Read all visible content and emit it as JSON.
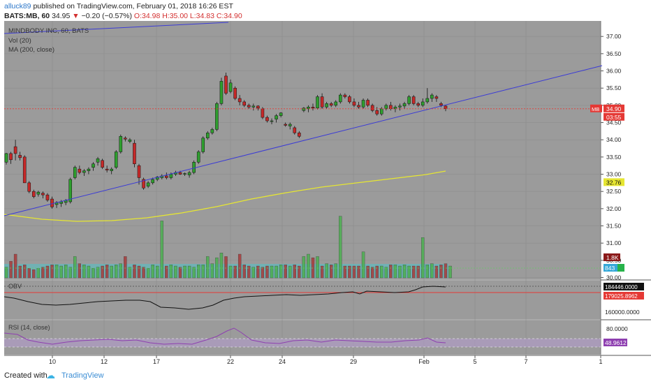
{
  "header": {
    "author": "alluck89",
    "published": "published on TradingView.com, February 01, 2018 16:26 EST",
    "symbol": "BATS:MB, 60",
    "last": "34.95",
    "change": "−0.20 (−0.57%)",
    "ohlc_o": "O:34.98",
    "ohlc_h": "H:35.00",
    "ohlc_l": "L:34.83",
    "ohlc_c": "C:34.90"
  },
  "legend": {
    "main": "MINDBODY INC, 60, BATS",
    "vol": "Vol (20)",
    "ma": "MA (200, close)",
    "obv": "OBV",
    "rsi": "RSI (14, close)"
  },
  "footer": {
    "created_with": "Created with",
    "brand": "TradingView"
  },
  "chart_data": {
    "type": "candlestick",
    "price_axis": {
      "ticks": [
        "37.00",
        "36.50",
        "36.00",
        "35.50",
        "35.00",
        "34.50",
        "34.00",
        "33.50",
        "33.00",
        "32.50",
        "32.00",
        "31.50",
        "31.00",
        "30.50",
        "30.00"
      ],
      "range": [
        29.95,
        37.45
      ]
    },
    "time_axis": {
      "ticks": [
        "10",
        "12",
        "17",
        "22",
        "24",
        "29",
        "Feb",
        "5",
        "7",
        "1"
      ]
    },
    "candles": [
      [
        33.35,
        33.62,
        33.28,
        33.6
      ],
      [
        33.6,
        33.65,
        33.3,
        33.42
      ],
      [
        33.8,
        34.0,
        33.4,
        33.6
      ],
      [
        33.55,
        33.65,
        33.4,
        33.48
      ],
      [
        33.5,
        33.55,
        32.8,
        32.75
      ],
      [
        32.75,
        32.8,
        32.45,
        32.5
      ],
      [
        32.5,
        32.55,
        32.3,
        32.35
      ],
      [
        32.42,
        32.52,
        32.35,
        32.48
      ],
      [
        32.45,
        32.5,
        32.3,
        32.4
      ],
      [
        32.4,
        32.45,
        32.2,
        32.25
      ],
      [
        32.28,
        32.35,
        32.0,
        32.05
      ],
      [
        32.12,
        32.22,
        32.02,
        32.18
      ],
      [
        32.15,
        32.25,
        32.05,
        32.2
      ],
      [
        32.18,
        32.28,
        32.1,
        32.24
      ],
      [
        32.2,
        32.9,
        32.15,
        32.85
      ],
      [
        32.9,
        33.25,
        32.85,
        33.2
      ],
      [
        33.15,
        33.25,
        33.0,
        33.05
      ],
      [
        33.05,
        33.15,
        32.95,
        33.1
      ],
      [
        33.1,
        33.2,
        33.0,
        33.15
      ],
      [
        33.2,
        33.35,
        33.1,
        33.3
      ],
      [
        33.35,
        33.5,
        33.25,
        33.45
      ],
      [
        33.4,
        33.45,
        33.15,
        33.2
      ],
      [
        33.15,
        33.25,
        33.05,
        33.12
      ],
      [
        33.1,
        33.2,
        33.0,
        33.15
      ],
      [
        33.2,
        33.7,
        33.15,
        33.65
      ],
      [
        33.65,
        34.15,
        33.6,
        34.1
      ],
      [
        34.05,
        34.1,
        33.95,
        34.02
      ],
      [
        33.95,
        34.05,
        33.9,
        34.0
      ],
      [
        33.9,
        34.0,
        33.2,
        33.3
      ],
      [
        33.25,
        33.3,
        32.7,
        32.9
      ],
      [
        32.85,
        32.9,
        32.55,
        32.6
      ],
      [
        32.65,
        32.8,
        32.6,
        32.75
      ],
      [
        32.75,
        32.9,
        32.7,
        32.85
      ],
      [
        32.85,
        32.95,
        32.8,
        32.92
      ],
      [
        32.9,
        33.0,
        32.85,
        32.95
      ],
      [
        32.95,
        33.05,
        32.85,
        32.9
      ],
      [
        32.9,
        33.05,
        32.85,
        33.0
      ],
      [
        33.0,
        33.1,
        32.95,
        33.05
      ],
      [
        33.05,
        33.1,
        32.98,
        33.0
      ],
      [
        33.0,
        33.05,
        32.95,
        33.02
      ],
      [
        32.98,
        33.1,
        32.9,
        33.05
      ],
      [
        33.05,
        33.4,
        33.0,
        33.35
      ],
      [
        33.35,
        33.7,
        33.3,
        33.65
      ],
      [
        33.65,
        34.1,
        33.6,
        34.05
      ],
      [
        34.05,
        34.25,
        34.0,
        34.2
      ],
      [
        34.2,
        34.35,
        34.15,
        34.3
      ],
      [
        34.3,
        35.1,
        34.25,
        35.05
      ],
      [
        35.05,
        35.8,
        35.0,
        35.7
      ],
      [
        35.85,
        35.95,
        35.3,
        35.35
      ],
      [
        35.4,
        35.75,
        35.35,
        35.65
      ],
      [
        35.5,
        35.55,
        35.15,
        35.2
      ],
      [
        35.2,
        35.3,
        35.0,
        35.1
      ],
      [
        35.1,
        35.15,
        34.95,
        35.0
      ],
      [
        35.0,
        35.05,
        34.9,
        34.95
      ],
      [
        34.95,
        35.05,
        34.85,
        34.98
      ],
      [
        34.98,
        35.0,
        34.85,
        34.92
      ],
      [
        34.9,
        34.95,
        34.6,
        34.65
      ],
      [
        34.65,
        34.7,
        34.5,
        34.55
      ],
      [
        34.55,
        34.62,
        34.45,
        34.55
      ],
      [
        34.6,
        34.75,
        34.5,
        34.7
      ],
      [
        34.7,
        34.8,
        34.65,
        34.78
      ],
      [
        34.45,
        34.5,
        34.38,
        34.42
      ],
      [
        34.4,
        34.5,
        34.3,
        34.45
      ],
      [
        34.35,
        34.4,
        34.15,
        34.2
      ],
      [
        34.2,
        34.25,
        34.05,
        34.1
      ],
      [
        34.85,
        34.95,
        34.8,
        34.92
      ],
      [
        34.9,
        35.0,
        34.8,
        34.95
      ],
      [
        34.95,
        35.05,
        34.85,
        34.92
      ],
      [
        34.92,
        35.3,
        34.88,
        35.25
      ],
      [
        35.25,
        35.35,
        34.9,
        34.95
      ],
      [
        34.95,
        35.1,
        34.9,
        35.05
      ],
      [
        35.05,
        35.1,
        34.95,
        35.0
      ],
      [
        35.0,
        35.15,
        34.95,
        35.1
      ],
      [
        35.1,
        35.35,
        35.05,
        35.3
      ],
      [
        35.3,
        35.35,
        35.2,
        35.25
      ],
      [
        35.25,
        35.3,
        35.05,
        35.1
      ],
      [
        35.1,
        35.2,
        34.95,
        35.0
      ],
      [
        35.0,
        35.1,
        34.9,
        34.95
      ],
      [
        34.95,
        35.2,
        34.9,
        35.15
      ],
      [
        35.15,
        35.2,
        34.95,
        35.0
      ],
      [
        35.0,
        35.05,
        34.8,
        34.85
      ],
      [
        34.85,
        34.95,
        34.7,
        34.75
      ],
      [
        34.75,
        34.95,
        34.7,
        34.9
      ],
      [
        34.9,
        35.05,
        34.85,
        35.0
      ],
      [
        35.0,
        35.1,
        34.85,
        34.9
      ],
      [
        34.9,
        35.0,
        34.8,
        34.95
      ],
      [
        34.95,
        35.05,
        34.85,
        34.98
      ],
      [
        34.98,
        35.1,
        34.9,
        35.05
      ],
      [
        35.05,
        35.3,
        35.0,
        35.25
      ],
      [
        35.25,
        35.3,
        35.0,
        35.05
      ],
      [
        35.05,
        35.1,
        34.95,
        35.0
      ],
      [
        35.0,
        35.2,
        34.95,
        35.1
      ],
      [
        35.1,
        35.5,
        35.05,
        35.2
      ],
      [
        35.2,
        35.35,
        35.1,
        35.3
      ],
      [
        35.25,
        35.3,
        35.1,
        35.2
      ],
      [
        35.05,
        35.1,
        34.95,
        35.0
      ],
      [
        34.98,
        35.0,
        34.83,
        34.9
      ]
    ],
    "volume": [
      0.45,
      0.7,
      1.0,
      0.5,
      0.55,
      0.4,
      0.35,
      0.4,
      0.45,
      0.5,
      0.55,
      0.55,
      0.5,
      0.55,
      0.45,
      0.9,
      0.6,
      0.55,
      0.5,
      0.4,
      0.45,
      0.5,
      0.55,
      0.5,
      0.55,
      0.6,
      0.9,
      0.45,
      0.55,
      0.5,
      0.45,
      0.4,
      0.55,
      0.5,
      2.4,
      0.5,
      0.55,
      0.5,
      0.45,
      0.5,
      0.5,
      0.45,
      0.55,
      0.55,
      0.9,
      0.6,
      0.85,
      1.05,
      0.9,
      0.5,
      0.5,
      1.0,
      0.55,
      0.5,
      0.45,
      0.5,
      0.45,
      0.5,
      0.5,
      0.5,
      0.55,
      0.55,
      0.5,
      0.55,
      0.5,
      0.9,
      1.0,
      0.85,
      0.9,
      0.5,
      0.6,
      0.55,
      0.6,
      2.6,
      0.5,
      0.5,
      0.5,
      0.5,
      1.1,
      0.5,
      0.45,
      0.5,
      0.5,
      0.45,
      0.55,
      0.55,
      0.5,
      0.55,
      0.5,
      0.5,
      0.5,
      1.7,
      0.55,
      0.6,
      0.5,
      0.55,
      0.6,
      0.5
    ],
    "volume_labels": {
      "last": "1.8K",
      "avg": "843"
    },
    "ma200": {
      "label": "32.76"
    },
    "price_label": {
      "symbol": "MB",
      "value": "34.90",
      "time": "03:55"
    },
    "obv": {
      "ticks": [
        "160000.0000"
      ],
      "labels": [
        "184446.0000",
        "179025.8962"
      ]
    },
    "rsi": {
      "ticks": [
        "80.0000"
      ],
      "label": "48.9612"
    }
  },
  "colors": {
    "up": "#2e9e2e",
    "down": "#c62828",
    "pane": "#9b9b9b",
    "trendline": "#3b3bd6",
    "ma": "#e6e632",
    "price_line": "#e53935",
    "obv_line": "#111111",
    "rsi_line": "#8e3fb0",
    "vol_avg": "#4fc3c8"
  }
}
